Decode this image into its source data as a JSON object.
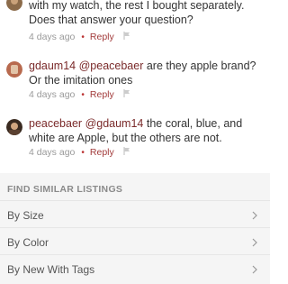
{
  "comments": [
    {
      "text": "with my watch, the rest I bought separately. Does that answer your question?",
      "time": "4 days ago",
      "reply_label": "Reply"
    },
    {
      "user": "gdaum14",
      "mention": "@peacebaer",
      "text": " are they apple brand? Or the imitation ones",
      "time": "4 days ago",
      "reply_label": "Reply"
    },
    {
      "user": "peacebaer",
      "mention": "@gdaum14",
      "text": " the coral, blue, and white are Apple, but the others are not.",
      "time": "4 days ago",
      "reply_label": "Reply"
    }
  ],
  "similar": {
    "title": "FIND SIMILAR LISTINGS",
    "items": [
      {
        "label": "By Size"
      },
      {
        "label": "By Color"
      },
      {
        "label": "By New With Tags"
      }
    ]
  },
  "colors": {
    "accent": "#a23b3b",
    "username": "#7a2a2a",
    "meta": "#9a9a9a",
    "section_bg": "#f5f5f5"
  }
}
